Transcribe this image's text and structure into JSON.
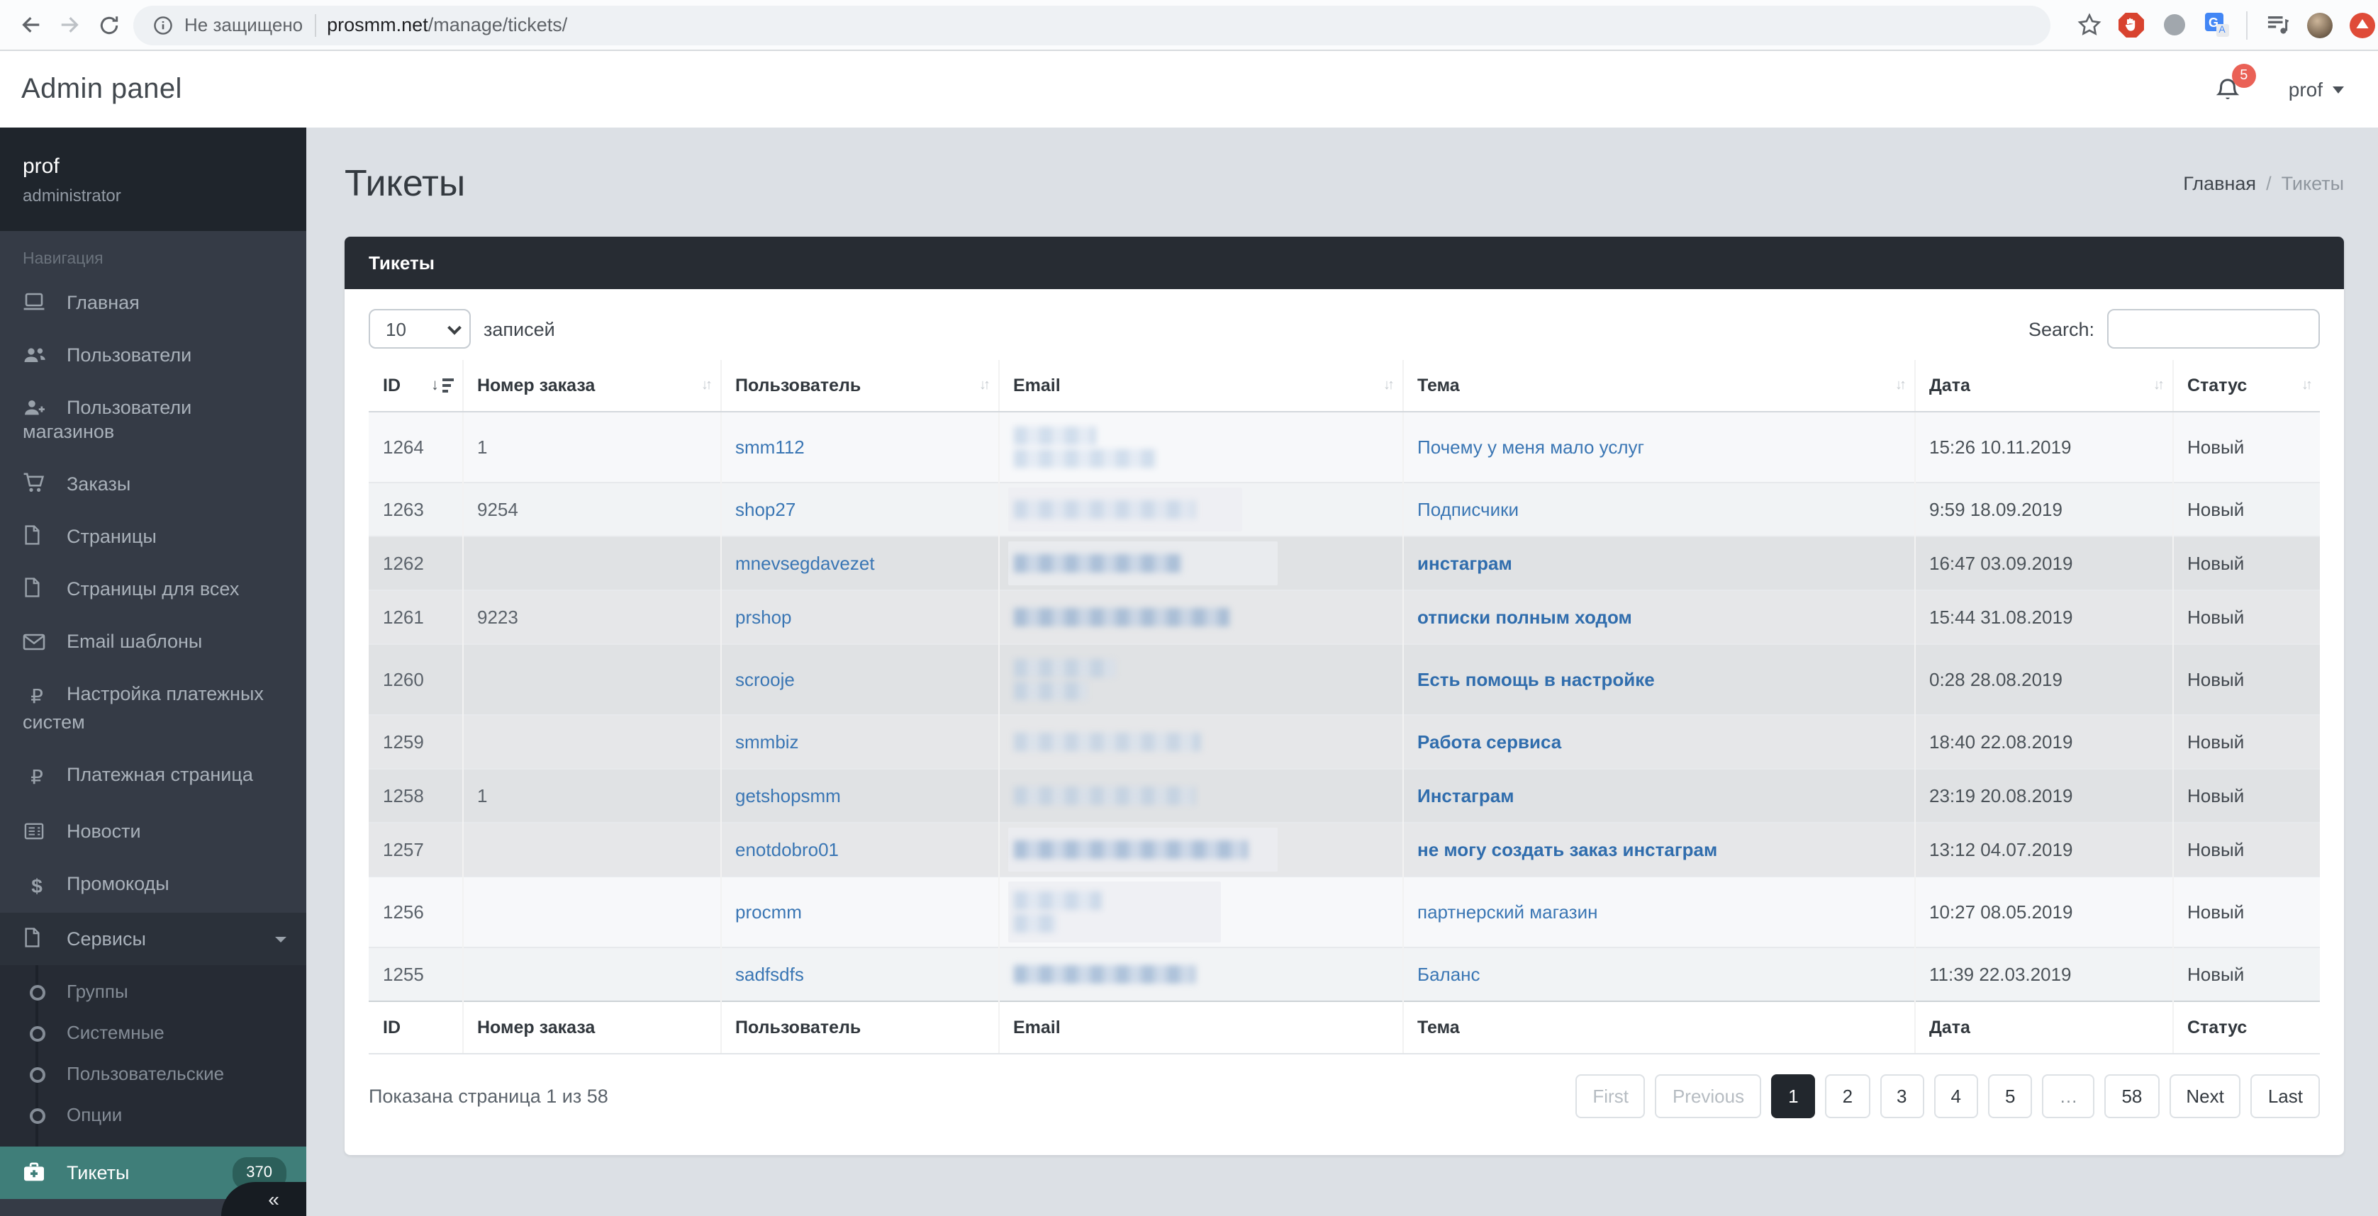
{
  "browser": {
    "security_label": "Не защищено",
    "url_host": "prosmm.net",
    "url_path": "/manage/tickets/"
  },
  "header": {
    "title": "Admin panel",
    "notifications_count": "5",
    "user_menu": "prof"
  },
  "sidebar": {
    "user": {
      "name": "prof",
      "role": "administrator"
    },
    "section_label": "Навигация",
    "items": [
      {
        "label": "Главная",
        "icon": "laptop"
      },
      {
        "label": "Пользователи",
        "icon": "users"
      },
      {
        "label": "Пользователи магазинов",
        "icon": "user-plus"
      },
      {
        "label": "Заказы",
        "icon": "cart"
      },
      {
        "label": "Страницы",
        "icon": "file"
      },
      {
        "label": "Страницы для всех",
        "icon": "file"
      },
      {
        "label": "Email шаблоны",
        "icon": "envelope"
      },
      {
        "label": "Настройка платежных систем",
        "icon": "ruble"
      },
      {
        "label": "Платежная страница",
        "icon": "ruble"
      },
      {
        "label": "Новости",
        "icon": "newspaper"
      },
      {
        "label": "Промокоды",
        "icon": "dollar"
      },
      {
        "label": "Сервисы",
        "icon": "file",
        "expanded": true,
        "children": [
          "Группы",
          "Системные",
          "Пользовательские",
          "Опции"
        ]
      },
      {
        "label": "Тикеты",
        "icon": "medkit",
        "active": true,
        "badge": "370"
      }
    ],
    "collapse_label": "«"
  },
  "page": {
    "title": "Тикеты",
    "breadcrumb_home": "Главная",
    "breadcrumb_separator": "/",
    "breadcrumb_current": "Тикеты"
  },
  "card": {
    "header": "Тикеты"
  },
  "controls": {
    "page_length_value": "10",
    "records_label": "записей",
    "search_label": "Search:"
  },
  "table": {
    "columns": [
      "ID",
      "Номер заказа",
      "Пользователь",
      "Email",
      "Тема",
      "Дата",
      "Статус"
    ],
    "sort": {
      "column": "ID",
      "direction": "desc"
    },
    "rows": [
      {
        "id": "1264",
        "order": "1",
        "user": "smm112",
        "subject": "Почему у меня мало услуг",
        "date": "15:26 10.11.2019",
        "status": "Новый",
        "unread": false,
        "email_blur": {
          "lines": [
            58,
            100
          ],
          "tone": "light",
          "backdrop": 0
        }
      },
      {
        "id": "1263",
        "order": "9254",
        "user": "shop27",
        "subject": "Подписчики",
        "date": "9:59 18.09.2019",
        "status": "Новый",
        "unread": false,
        "email_blur": {
          "lines": [
            128
          ],
          "tone": "light",
          "backdrop": 165
        }
      },
      {
        "id": "1262",
        "order": "",
        "user": "mnevsegdavezet",
        "subject": "инстаграм",
        "date": "16:47 03.09.2019",
        "status": "Новый",
        "unread": true,
        "email_blur": {
          "lines": [
            118
          ],
          "tone": "medium",
          "backdrop": 190
        }
      },
      {
        "id": "1261",
        "order": "9223",
        "user": "prshop",
        "subject": "отписки полным ходом",
        "date": "15:44 31.08.2019",
        "status": "Новый",
        "unread": true,
        "email_blur": {
          "lines": [
            152
          ],
          "tone": "medium",
          "backdrop": 0
        }
      },
      {
        "id": "1260",
        "order": "",
        "user": "scrooje",
        "subject": "Есть помощь в настройке",
        "date": "0:28 28.08.2019",
        "status": "Новый",
        "unread": true,
        "email_blur": {
          "lines": [
            72,
            52
          ],
          "tone": "light",
          "backdrop": 0
        }
      },
      {
        "id": "1259",
        "order": "",
        "user": "smmbiz",
        "subject": "Работа сервиса",
        "date": "18:40 22.08.2019",
        "status": "Новый",
        "unread": true,
        "email_blur": {
          "lines": [
            132
          ],
          "tone": "light",
          "backdrop": 0
        }
      },
      {
        "id": "1258",
        "order": "1",
        "user": "getshopsmm",
        "subject": "Инстаграм",
        "date": "23:19 20.08.2019",
        "status": "Новый",
        "unread": true,
        "email_blur": {
          "lines": [
            128
          ],
          "tone": "light",
          "backdrop": 0
        }
      },
      {
        "id": "1257",
        "order": "",
        "user": "enotdobro01",
        "subject": "не могу создать заказ инстаграм",
        "date": "13:12 04.07.2019",
        "status": "Новый",
        "unread": true,
        "email_blur": {
          "lines": [
            165
          ],
          "tone": "medium",
          "backdrop": 190
        }
      },
      {
        "id": "1256",
        "order": "",
        "user": "procmm",
        "subject": "партнерский магазин",
        "date": "10:27 08.05.2019",
        "status": "Новый",
        "unread": false,
        "email_blur": {
          "lines": [
            62,
            30
          ],
          "tone": "light",
          "backdrop": 150
        }
      },
      {
        "id": "1255",
        "order": "",
        "user": "sadfsdfs",
        "subject": "Баланс",
        "date": "11:39 22.03.2019",
        "status": "Новый",
        "unread": false,
        "email_blur": {
          "lines": [
            128
          ],
          "tone": "medium",
          "backdrop": 0
        }
      }
    ]
  },
  "footer": {
    "info": "Показана страница 1 из 58",
    "pagination": [
      {
        "label": "First",
        "state": "disabled"
      },
      {
        "label": "Previous",
        "state": "disabled"
      },
      {
        "label": "1",
        "state": "active"
      },
      {
        "label": "2",
        "state": "normal"
      },
      {
        "label": "3",
        "state": "normal"
      },
      {
        "label": "4",
        "state": "normal"
      },
      {
        "label": "5",
        "state": "normal"
      },
      {
        "label": "…",
        "state": "ellipsis"
      },
      {
        "label": "58",
        "state": "normal"
      },
      {
        "label": "Next",
        "state": "normal"
      },
      {
        "label": "Last",
        "state": "normal"
      }
    ]
  }
}
